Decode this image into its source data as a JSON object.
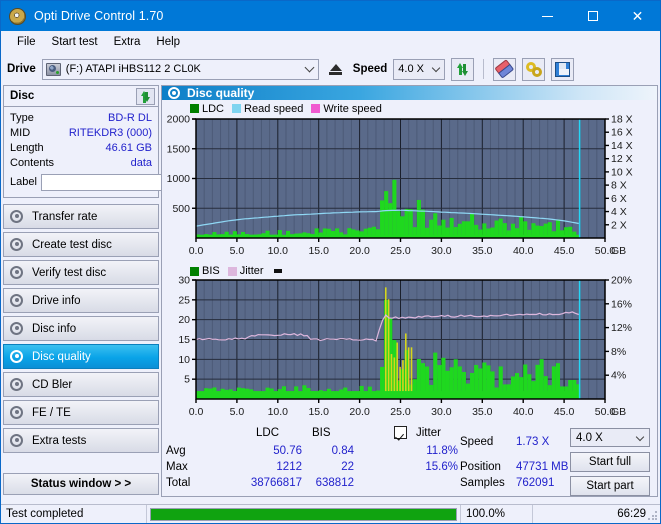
{
  "window": {
    "title": "Opti Drive Control 1.70",
    "icon": "disc-icon",
    "minimize": "–",
    "maximize": "□",
    "close": "✕"
  },
  "menu": {
    "items": [
      "File",
      "Start test",
      "Extra",
      "Help"
    ]
  },
  "toolbar": {
    "drive_label": "Drive",
    "drive_value": "(F:)  ATAPI iHBS112  2 CL0K",
    "eject_icon": "eject-icon",
    "speed_label": "Speed",
    "speed_value": "4.0 X",
    "refresh_icon": "refresh-icon",
    "eraser_icon": "eraser-icon",
    "tools_icon": "tools-icon",
    "save_icon": "save-icon"
  },
  "sidebar": {
    "disc_panel": {
      "title": "Disc",
      "refresh_icon": "refresh-icon",
      "rows": [
        {
          "key": "Type",
          "value": "BD-R DL"
        },
        {
          "key": "MID",
          "value": "RITEKDR3 (000)"
        },
        {
          "key": "Length",
          "value": "46.61 GB"
        },
        {
          "key": "Contents",
          "value": "data"
        }
      ],
      "label_key": "Label",
      "label_value": "",
      "label_placeholder": "",
      "disc_button_icon": "cd-disc-icon"
    },
    "nav": [
      {
        "label": "Transfer rate",
        "active": false
      },
      {
        "label": "Create test disc",
        "active": false
      },
      {
        "label": "Verify test disc",
        "active": false
      },
      {
        "label": "Drive info",
        "active": false
      },
      {
        "label": "Disc info",
        "active": false
      },
      {
        "label": "Disc quality",
        "active": true
      },
      {
        "label": "CD Bler",
        "active": false
      },
      {
        "label": "FE / TE",
        "active": false
      },
      {
        "label": "Extra tests",
        "active": false
      }
    ],
    "status_window_button": "Status window > >"
  },
  "content": {
    "header_title": "Disc quality",
    "header_icon": "disc-quality-icon"
  },
  "stats": {
    "col_headers": [
      "LDC",
      "BIS"
    ],
    "jitter_label": "Jitter",
    "jitter_checked": true,
    "rows": [
      {
        "name": "Avg",
        "ldc": "50.76",
        "bis": "0.84",
        "jitter": "11.8%"
      },
      {
        "name": "Max",
        "ldc": "1212",
        "bis": "22",
        "jitter": "15.6%"
      },
      {
        "name": "Total",
        "ldc": "38766817",
        "bis": "638812",
        "jitter": ""
      }
    ],
    "speed_label": "Speed",
    "speed_value": "1.73 X",
    "position_label": "Position",
    "position_value": "47731 MB",
    "samples_label": "Samples",
    "samples_value": "762091",
    "speed_select_value": "4.0 X",
    "start_full_button": "Start full",
    "start_part_button": "Start part"
  },
  "statusbar": {
    "message": "Test completed",
    "progress_percent": "100.0%",
    "progress_value": 100,
    "elapsed": "66:29"
  },
  "colors": {
    "accent": "#0078d7",
    "plot_bg": "#5a6a8a",
    "grid": "#353f52",
    "ldc_green": "#1fd81f",
    "bis_green": "#1fd81f",
    "read_speed": "#8fd8f5",
    "write_speed": "#f05ad0",
    "jitter": "#ddb7dd",
    "yellow": "#d8d81f",
    "value_blue": "#2222cc",
    "progress_green": "#10a310"
  },
  "chart_data": [
    {
      "type": "area",
      "title": "Disc quality - LDC",
      "legend": [
        {
          "label": "LDC",
          "color": "#008000"
        },
        {
          "label": "Read speed",
          "color": "#7fd4f0"
        },
        {
          "label": "Write speed",
          "color": "#f05ad0"
        }
      ],
      "legend_position": "top-left",
      "xlabel": "GB",
      "ylabel": "LDC",
      "y2label": "X",
      "xlim": [
        0,
        50
      ],
      "ylim": [
        0,
        2000
      ],
      "y2lim": [
        0,
        18
      ],
      "xticks": [
        "0.0",
        "5.0",
        "10.0",
        "15.0",
        "20.0",
        "25.0",
        "30.0",
        "35.0",
        "40.0",
        "45.0",
        "50.0"
      ],
      "yticks": [
        500,
        1000,
        1500,
        2000
      ],
      "y2ticks": [
        "2 X",
        "4 X",
        "6 X",
        "8 X",
        "10 X",
        "12 X",
        "14 X",
        "16 X",
        "18 X"
      ],
      "grid": true,
      "series": [
        {
          "name": "LDC",
          "color": "#1fd81f",
          "type": "area",
          "x": [
            0,
            1,
            2,
            3,
            4,
            5,
            6,
            7,
            8,
            9,
            10,
            11,
            12,
            13,
            14,
            15,
            16,
            17,
            18,
            19,
            20,
            21,
            22,
            23,
            23.3,
            23.6,
            24,
            24.4,
            24.8,
            25.2,
            25.6,
            26,
            26.5,
            27,
            27.5,
            28,
            28.5,
            29,
            29.5,
            30,
            30.5,
            31,
            32,
            33,
            34,
            35,
            36,
            37,
            38,
            39,
            40,
            41,
            42,
            43,
            44,
            45,
            46,
            46.8
          ],
          "y": [
            60,
            70,
            80,
            70,
            90,
            80,
            95,
            110,
            90,
            100,
            120,
            110,
            130,
            120,
            140,
            130,
            150,
            140,
            160,
            150,
            170,
            160,
            180,
            1212,
            1000,
            950,
            760,
            700,
            520,
            560,
            600,
            480,
            520,
            560,
            430,
            400,
            460,
            400,
            520,
            420,
            380,
            360,
            340,
            360,
            330,
            350,
            320,
            340,
            300,
            330,
            310,
            300,
            290,
            280,
            260,
            230,
            120
          ]
        },
        {
          "name": "Read speed",
          "color": "#8fd8f5",
          "type": "line",
          "x": [
            0,
            2,
            4,
            6,
            8,
            10,
            12,
            14,
            16,
            18,
            20,
            22,
            23.3,
            25,
            27,
            29,
            31,
            33,
            35,
            37,
            39,
            41,
            43,
            45,
            46.8
          ],
          "y_x_units": [
            1.8,
            2.2,
            2.6,
            2.9,
            3.1,
            3.3,
            3.5,
            3.6,
            3.75,
            3.85,
            3.95,
            4.0,
            4.15,
            4.2,
            4.1,
            4.0,
            3.85,
            3.75,
            3.6,
            3.45,
            3.3,
            3.1,
            2.9,
            2.6,
            2.2
          ]
        }
      ],
      "marker_line_gb": 46.9,
      "marker_color": "#25d5f5"
    },
    {
      "type": "area",
      "title": "Disc quality - BIS / Jitter",
      "legend": [
        {
          "label": "BIS",
          "color": "#008000"
        },
        {
          "label": "Jitter",
          "color": "#ddb7dd"
        }
      ],
      "legend_position": "top-left",
      "xlabel": "GB",
      "ylabel": "BIS",
      "y2label": "%",
      "xlim": [
        0,
        50
      ],
      "ylim": [
        0,
        30
      ],
      "y2lim": [
        0,
        20
      ],
      "xticks": [
        "0.0",
        "5.0",
        "10.0",
        "15.0",
        "20.0",
        "25.0",
        "30.0",
        "35.0",
        "40.0",
        "45.0",
        "50.0"
      ],
      "yticks": [
        5,
        10,
        15,
        20,
        25,
        30
      ],
      "y2ticks": [
        "4%",
        "8%",
        "12%",
        "16%",
        "20%"
      ],
      "grid": true,
      "series": [
        {
          "name": "BIS",
          "color": "#1fd81f",
          "type": "area",
          "x": [
            0,
            1,
            2,
            3,
            4,
            5,
            6,
            7,
            8,
            9,
            10,
            11,
            12,
            13,
            14,
            15,
            16,
            17,
            18,
            19,
            20,
            21,
            22,
            23,
            23.2,
            23.5,
            24,
            24.5,
            25,
            25.5,
            26,
            26.5,
            27,
            28,
            29,
            30,
            31,
            32,
            33,
            34,
            35,
            36,
            37,
            38,
            39,
            40,
            41,
            42,
            43,
            44,
            45,
            46,
            46.8
          ],
          "y": [
            2.2,
            2.4,
            2.5,
            2.3,
            2.6,
            2.8,
            2.5,
            2.7,
            3.0,
            2.8,
            3.2,
            3.0,
            3.1,
            2.9,
            3.2,
            3.0,
            3.1,
            2.9,
            3.0,
            2.8,
            2.9,
            2.7,
            2.6,
            22,
            20,
            17,
            13,
            11,
            10.5,
            16.5,
            9.5,
            9,
            8.5,
            8,
            9,
            11,
            8.5,
            8,
            8.5,
            9,
            8,
            8.5,
            8,
            9,
            8.5,
            8,
            10,
            8.5,
            9,
            8,
            8.5,
            7.5,
            5
          ]
        },
        {
          "name": "Jitter",
          "color": "#ddb7dd",
          "type": "line",
          "x": [
            0,
            2,
            4,
            6,
            6.6,
            8,
            10,
            12,
            13.8,
            14,
            16,
            18,
            20,
            22,
            23.1,
            23.4,
            25,
            27,
            29,
            31,
            33,
            35,
            37,
            39,
            41,
            43,
            45,
            46,
            46.8
          ],
          "y_pct": [
            10.0,
            10.0,
            10.1,
            10.2,
            10.6,
            10.7,
            10.8,
            10.9,
            10.7,
            9.9,
            10.0,
            10.1,
            10.0,
            9.9,
            14.3,
            13.6,
            13.7,
            13.8,
            13.9,
            13.9,
            14.0,
            14.0,
            14.1,
            14.1,
            14.2,
            14.3,
            14.4,
            14.6,
            14.2
          ]
        }
      ],
      "marker_line_gb": 46.9,
      "marker_color": "#25d5f5"
    }
  ]
}
